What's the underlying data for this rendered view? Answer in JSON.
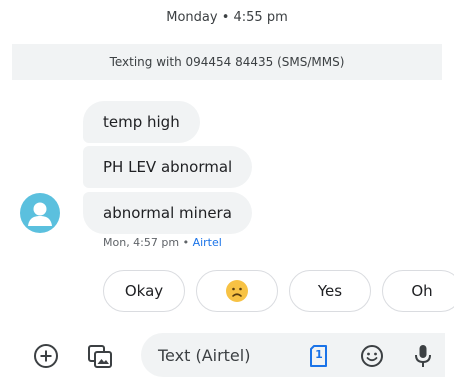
{
  "header": {
    "date_time": "Monday • 4:55 pm"
  },
  "banner": {
    "text": "Texting with 094454 84435 (SMS/MMS)"
  },
  "messages": [
    {
      "text": "temp high"
    },
    {
      "text": "PH LEV abnormal"
    },
    {
      "text": "abnormal minera"
    }
  ],
  "message_meta": {
    "time": "Mon, 4:57 pm • ",
    "carrier": "Airtel"
  },
  "suggestions": [
    {
      "label": "Okay"
    },
    {
      "label": "",
      "icon": "sad-face-emoji"
    },
    {
      "label": "Yes"
    },
    {
      "label": "Oh"
    }
  ],
  "composer": {
    "placeholder": "Text (Airtel)",
    "sim_number": "1",
    "icons": [
      "add-icon",
      "gallery-icon",
      "sim-icon",
      "emoji-icon",
      "mic-icon"
    ]
  },
  "colors": {
    "accent": "#1a73e8",
    "avatar": "#5bc0de",
    "bubble": "#f1f3f4",
    "emoji": "#f7c244"
  }
}
